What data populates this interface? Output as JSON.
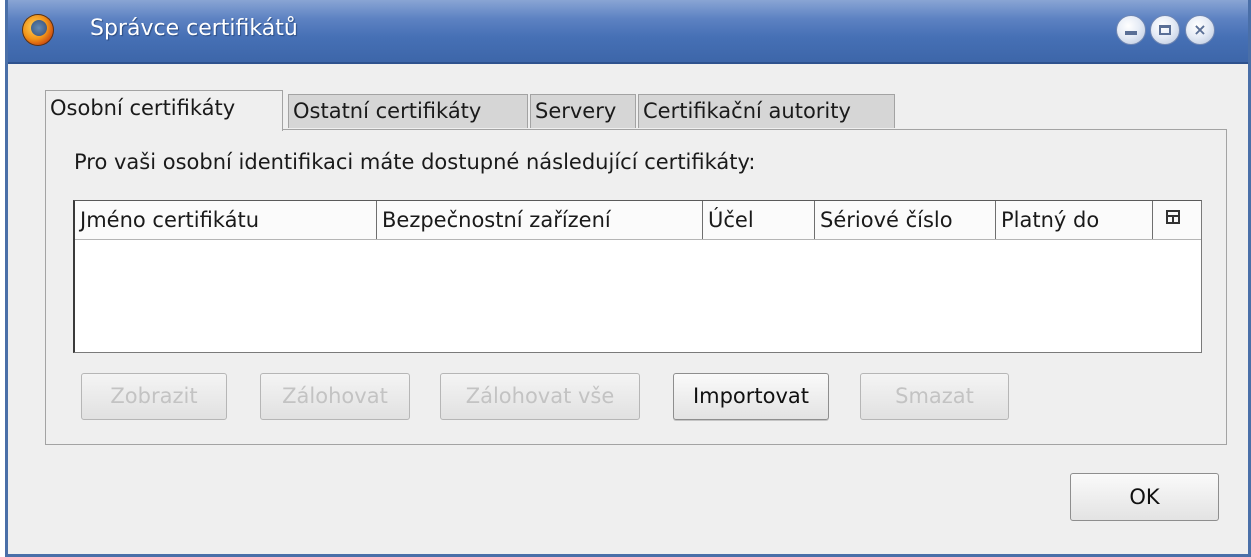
{
  "window": {
    "title": "Správce certifikátů",
    "controls": {
      "minimize": "minimize",
      "maximize": "maximize",
      "close": "×"
    }
  },
  "tabs": [
    {
      "label": "Osobní certifikáty",
      "active": true
    },
    {
      "label": "Ostatní certifikáty",
      "active": false
    },
    {
      "label": "Servery",
      "active": false
    },
    {
      "label": "Certifikační autority",
      "active": false
    }
  ],
  "panel": {
    "instruction": "Pro vaši osobní identifikaci máte dostupné následující certifikáty:",
    "columns": [
      "Jméno certifikátu",
      "Bezpečnostní zařízení",
      "Účel",
      "Sériové číslo",
      "Platný do"
    ],
    "column_picker_icon": "column-picker-icon",
    "rows": []
  },
  "buttons": {
    "view": {
      "label": "Zobrazit",
      "enabled": false
    },
    "backup": {
      "label": "Zálohovat",
      "enabled": false
    },
    "backup_all": {
      "label": "Zálohovat vše",
      "enabled": false
    },
    "import": {
      "label": "Importovat",
      "enabled": true
    },
    "delete": {
      "label": "Smazat",
      "enabled": false
    },
    "ok": {
      "label": "OK",
      "enabled": true
    }
  }
}
